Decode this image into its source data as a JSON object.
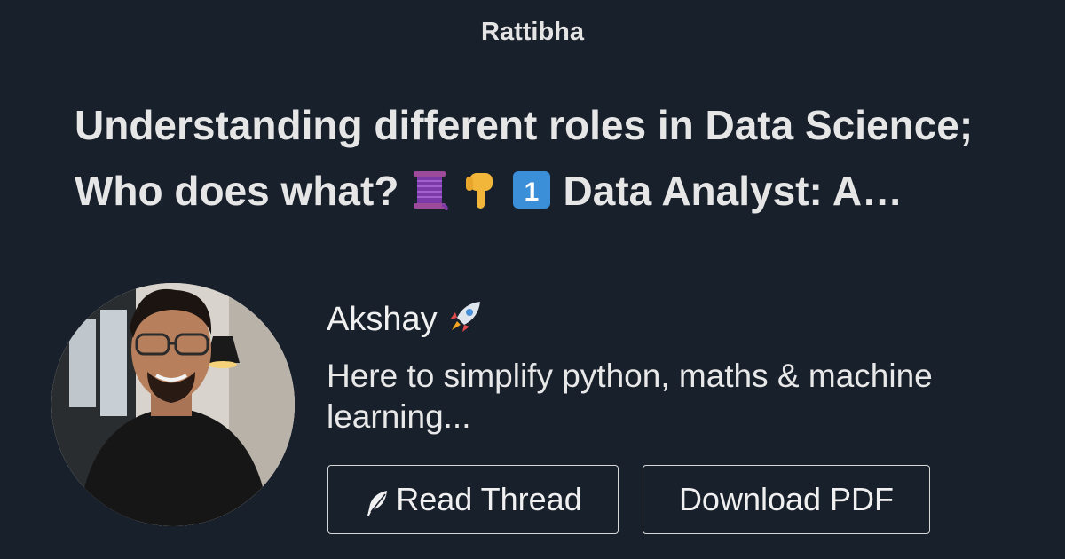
{
  "site": {
    "name": "Rattibha"
  },
  "thread": {
    "title_line1": "Understanding different roles in Data Science;",
    "title_line2_text": "Who does what?",
    "title_line2_tail": "Data Analyst: A…",
    "title_emojis": [
      "thread-spool-icon",
      "pointing-down-icon",
      "keycap-1-icon"
    ]
  },
  "author": {
    "name": "Akshay",
    "name_emoji": "rocket-icon",
    "bio": "Here to simplify python, maths & machine learning..."
  },
  "actions": {
    "read_label": "Read Thread",
    "read_icon": "feather-icon",
    "download_label": "Download PDF"
  },
  "colors": {
    "background": "#18202c",
    "text": "#e6e6e6",
    "button_border": "#d7d7d7"
  }
}
